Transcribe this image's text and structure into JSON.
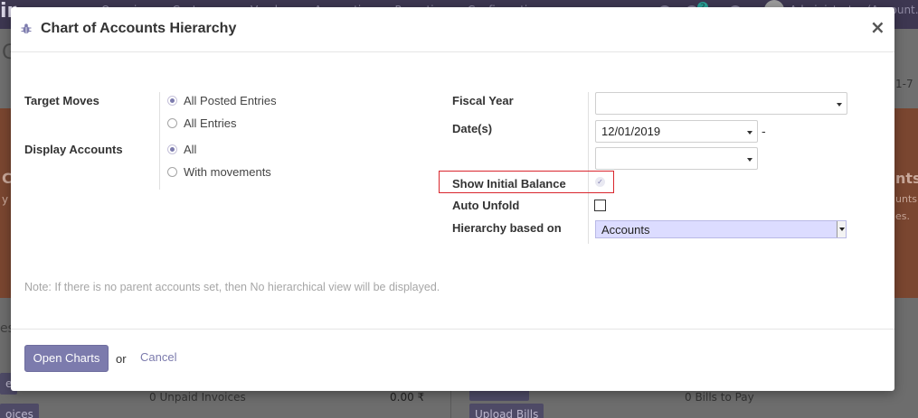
{
  "background": {
    "brand": "ir",
    "menu": [
      "Overview",
      "Customers",
      "Vendors",
      "Accounting",
      "Reporting",
      "Configuration"
    ],
    "chat_badge": "2",
    "user_name": "Administrator (Account...",
    "pager": "1-7",
    "banner_left_title": "C",
    "banner_left_text": "y",
    "banner_right_title": "nts",
    "banner_right_text1": "unts",
    "banner_right_text2": "es.",
    "section_letter": "es",
    "unpaid_invoices": "0 Unpaid Invoices",
    "unpaid_amount": "0.00 ₹",
    "bills_to_pay": "0 Bills to Pay",
    "btn_left1": "e",
    "btn_left2": "oices",
    "btn_right2": "Upload Bills"
  },
  "dialog": {
    "title": "Chart of Accounts Hierarchy",
    "close": "×",
    "target_moves": {
      "label": "Target Moves",
      "options": [
        "All Posted Entries",
        "All Entries"
      ],
      "selected": "All Posted Entries"
    },
    "display_accounts": {
      "label": "Display Accounts",
      "options": [
        "All",
        "With movements"
      ],
      "selected": "All"
    },
    "fiscal_year": {
      "label": "Fiscal Year",
      "value": ""
    },
    "dates": {
      "label": "Date(s)",
      "from": "12/01/2019",
      "separator": "-",
      "to": ""
    },
    "show_initial_balance": {
      "label": "Show Initial Balance",
      "checked": true
    },
    "auto_unfold": {
      "label": "Auto Unfold",
      "checked": false
    },
    "hierarchy_based_on": {
      "label": "Hierarchy based on",
      "value": "Accounts"
    },
    "note": "Note: If there is no parent accounts set, then No hierarchical view will be displayed.",
    "footer": {
      "primary": "Open Charts",
      "or": "or",
      "cancel": "Cancel"
    }
  },
  "colors": {
    "accent": "#7c7bad",
    "highlight_border": "#d9262d",
    "select_highlight": "#dcdcff"
  }
}
